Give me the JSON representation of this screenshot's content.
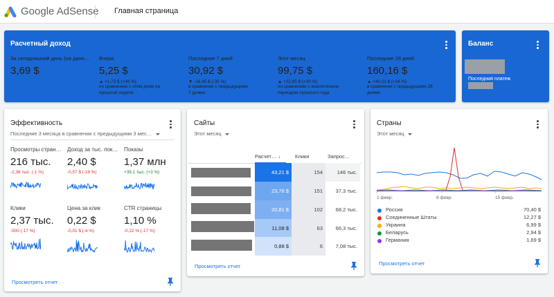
{
  "header": {
    "brand": "Google AdSense",
    "page_title": "Главная страница"
  },
  "colors": {
    "brand_blue": "#1967d2",
    "link_blue": "#1a73e8",
    "negative": "#d93025",
    "positive": "#188038"
  },
  "revenue": {
    "title": "Расчетный доход",
    "columns": [
      {
        "label": "За сегодняшний день (на данн…",
        "value": "3,69 $",
        "change": "",
        "compare": ""
      },
      {
        "label": "Вчера",
        "value": "5,25 $",
        "change": "▲ +1,73 $ (+49 %)",
        "compare": "по сравнению с этим днем на прошлой неделе"
      },
      {
        "label": "Последние 7 дней",
        "value": "30,92 $",
        "change": "▼ -16,45 $ (-35 %)",
        "compare": "в сравнении с предыдущими 7 днями"
      },
      {
        "label": "Этот месяц",
        "value": "99,75 $",
        "change": "▲ +22,95 $ (+30 %)",
        "compare": "по сравнению с аналогичным периодом прошлого года"
      },
      {
        "label": "Последние 28 дней",
        "value": "160,16 $",
        "change": "▲ +40,21 $ (+34 %)",
        "compare": "в сравнении с предыдущими 28 днями"
      }
    ]
  },
  "balance": {
    "title": "Баланс",
    "last_payment_label": "Последний платеж"
  },
  "performance": {
    "title": "Эффективность",
    "period": "Последние 3 месяца в сравнении с предыдущими 3 мес…",
    "metrics": [
      {
        "label": "Просмотры стран…",
        "value": "216 тыс.",
        "change": "-2,38 тыс. (-1 %)",
        "trend": "negative"
      },
      {
        "label": "Доход за тыс. пок…",
        "value": "2,40 $",
        "change": "-0,57 $ (-19 %)",
        "trend": "negative"
      },
      {
        "label": "Показы",
        "value": "1,37 млн",
        "change": "+39,1 тыс. (+3 %)",
        "trend": "positive"
      },
      {
        "label": "Клики",
        "value": "2,37 тыс.",
        "change": "-500 (-17 %)",
        "trend": "negative"
      },
      {
        "label": "Цена за клик",
        "value": "0,22 $",
        "change": "-0,01 $ (-4 %)",
        "trend": "negative"
      },
      {
        "label": "CTR страницы",
        "value": "1,10 %",
        "change": "-0,22 % (-17 %)",
        "trend": "negative"
      }
    ],
    "link": "Просмотреть отчет"
  },
  "sites": {
    "title": "Сайты",
    "period": "Этот месяц",
    "headers": [
      "Расчет…",
      "Клики",
      "Запрос…"
    ],
    "rows": [
      {
        "rpm": "43,21 $",
        "clicks": "154",
        "rpm_clicks": "146 тыс.",
        "share": 1.0
      },
      {
        "rpm": "23,76 $",
        "clicks": "151",
        "rpm_clicks": "37,3 тыс.",
        "share": 0.55
      },
      {
        "rpm": "20,81 $",
        "clicks": "102",
        "rpm_clicks": "68,2 тыс.",
        "share": 0.48
      },
      {
        "rpm": "11,08 $",
        "clicks": "63",
        "rpm_clicks": "66,3 тыс.",
        "share": 0.26
      },
      {
        "rpm": "0,88 $",
        "clicks": "6",
        "rpm_clicks": "7,08 тыс.",
        "share": 0.02
      }
    ],
    "link": "Просмотреть отчет"
  },
  "countries": {
    "title": "Страны",
    "period": "Этот месяц",
    "x_labels": [
      "1 февр.",
      "8 февр.",
      "15 февр."
    ],
    "items": [
      {
        "name": "Россия",
        "value": "70,40 $",
        "color": "#1a73e8"
      },
      {
        "name": "Соединенные Штаты",
        "value": "12,27 $",
        "color": "#d93025"
      },
      {
        "name": "Украина",
        "value": "6,99 $",
        "color": "#f9ab00"
      },
      {
        "name": "Беларусь",
        "value": "2,94 $",
        "color": "#1e8e3e"
      },
      {
        "name": "Германия",
        "value": "1,69 $",
        "color": "#9334e6"
      }
    ],
    "link": "Просмотреть отчет"
  }
}
